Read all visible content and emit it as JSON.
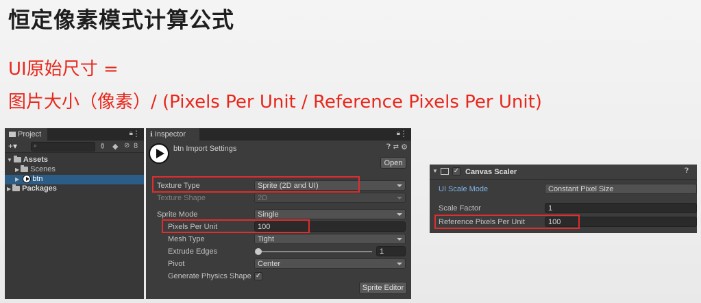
{
  "slide": {
    "title": "恒定像素模式计算公式",
    "formula_line1": "UI原始尺寸 =",
    "formula_line2": "图片大小（像素）/ (Pixels Per Unit / Reference Pixels Per Unit)"
  },
  "colors": {
    "formula_red": "#e8271c",
    "highlight_red": "#e02d2d",
    "unity_panel": "#383838",
    "selection_blue": "#2c5d87"
  },
  "project": {
    "tab_label": "Project",
    "add_label": "+▾",
    "search_placeholder": "",
    "hidden_count": "8",
    "tree": [
      {
        "label": "Assets",
        "level": 0
      },
      {
        "label": "Scenes",
        "level": 1
      },
      {
        "label": "btn",
        "level": 1,
        "selected": true
      },
      {
        "label": "Packages",
        "level": 0
      }
    ]
  },
  "inspector": {
    "tab_label": "Inspector",
    "asset_title": "btn Import Settings",
    "open_button": "Open",
    "rows": {
      "texture_type": {
        "label": "Texture Type",
        "value": "Sprite (2D and UI)"
      },
      "texture_shape": {
        "label": "Texture Shape",
        "value": "2D"
      },
      "sprite_mode": {
        "label": "Sprite Mode",
        "value": "Single"
      },
      "pixels_per_unit": {
        "label": "Pixels Per Unit",
        "value": "100"
      },
      "mesh_type": {
        "label": "Mesh Type",
        "value": "Tight"
      },
      "extrude_edges": {
        "label": "Extrude Edges",
        "value": "1"
      },
      "pivot": {
        "label": "Pivot",
        "value": "Center"
      },
      "generate_physics_shape": {
        "label": "Generate Physics Shape",
        "checked": true
      }
    },
    "sprite_editor_button": "Sprite Editor"
  },
  "canvas_scaler": {
    "title": "Canvas Scaler",
    "rows": {
      "ui_scale_mode": {
        "label": "UI Scale Mode",
        "value": "Constant Pixel Size"
      },
      "scale_factor": {
        "label": "Scale Factor",
        "value": "1"
      },
      "reference_ppu": {
        "label": "Reference Pixels Per Unit",
        "value": "100"
      }
    }
  }
}
